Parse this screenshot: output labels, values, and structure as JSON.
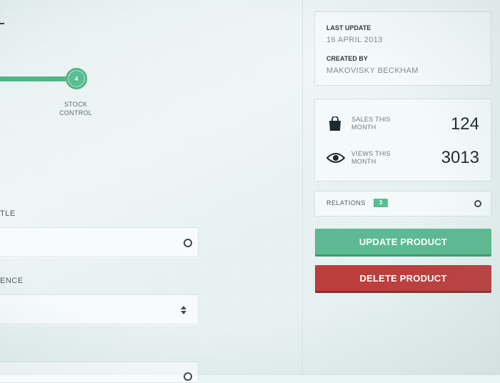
{
  "stepper": {
    "current_step": "4",
    "current_label": "STOCK CONTROL"
  },
  "form": {
    "fields": [
      {
        "label": "TLE",
        "control": "text-input"
      },
      {
        "label": "ENCE",
        "control": "select"
      }
    ]
  },
  "meta": {
    "last_update_heading": "LAST UPDATE",
    "last_update_value": "16 APRIL 2013",
    "created_by_heading": "CREATED BY",
    "created_by_value": "MAKOVISKY BECKHAM"
  },
  "stats": {
    "sales_label": "SALES THIS MONTH",
    "sales_value": "124",
    "sales_icon": "shopping-bag-icon",
    "views_label": "VIEWS THIS MONTH",
    "views_value": "3013",
    "views_icon": "eye-icon"
  },
  "relations": {
    "label": "RELATIONS",
    "count": "3"
  },
  "actions": {
    "update_label": "UPDATE PRODUCT",
    "delete_label": "DELETE PRODUCT"
  },
  "colors": {
    "accent_green": "#5dba92",
    "danger_red": "#bd3d3c",
    "background": "#e9f4f3"
  }
}
